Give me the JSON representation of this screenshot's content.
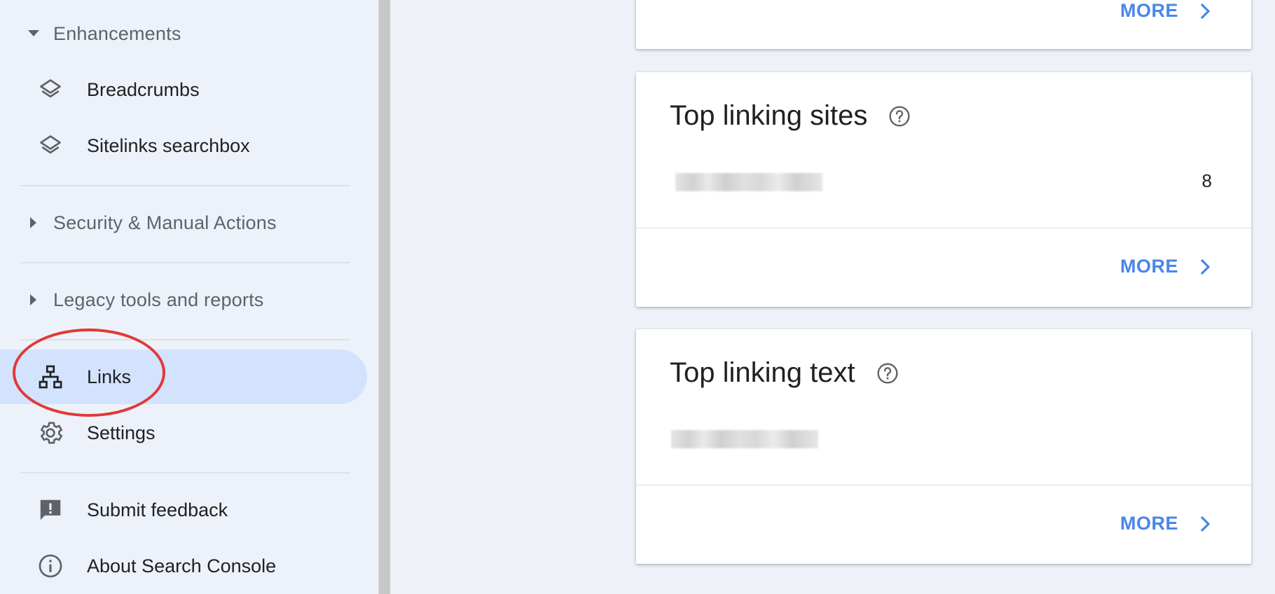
{
  "sidebar": {
    "enhancements_header": "Enhancements",
    "enhancements_items": [
      {
        "label": "Breadcrumbs",
        "icon": "layers-icon"
      },
      {
        "label": "Sitelinks searchbox",
        "icon": "layers-icon"
      }
    ],
    "security_header": "Security & Manual Actions",
    "legacy_header": "Legacy tools and reports",
    "links_label": "Links",
    "settings_label": "Settings",
    "feedback_label": "Submit feedback",
    "about_label": "About Search Console"
  },
  "cards": {
    "top_card": {
      "more_label": "MORE"
    },
    "top_linking_sites": {
      "title": "Top linking sites",
      "row_count": "8",
      "more_label": "MORE"
    },
    "top_linking_text": {
      "title": "Top linking text",
      "more_label": "MORE"
    }
  },
  "colors": {
    "accent": "#4a86e8",
    "active_bg": "#d3e3fd",
    "annotation": "#e03a36"
  }
}
